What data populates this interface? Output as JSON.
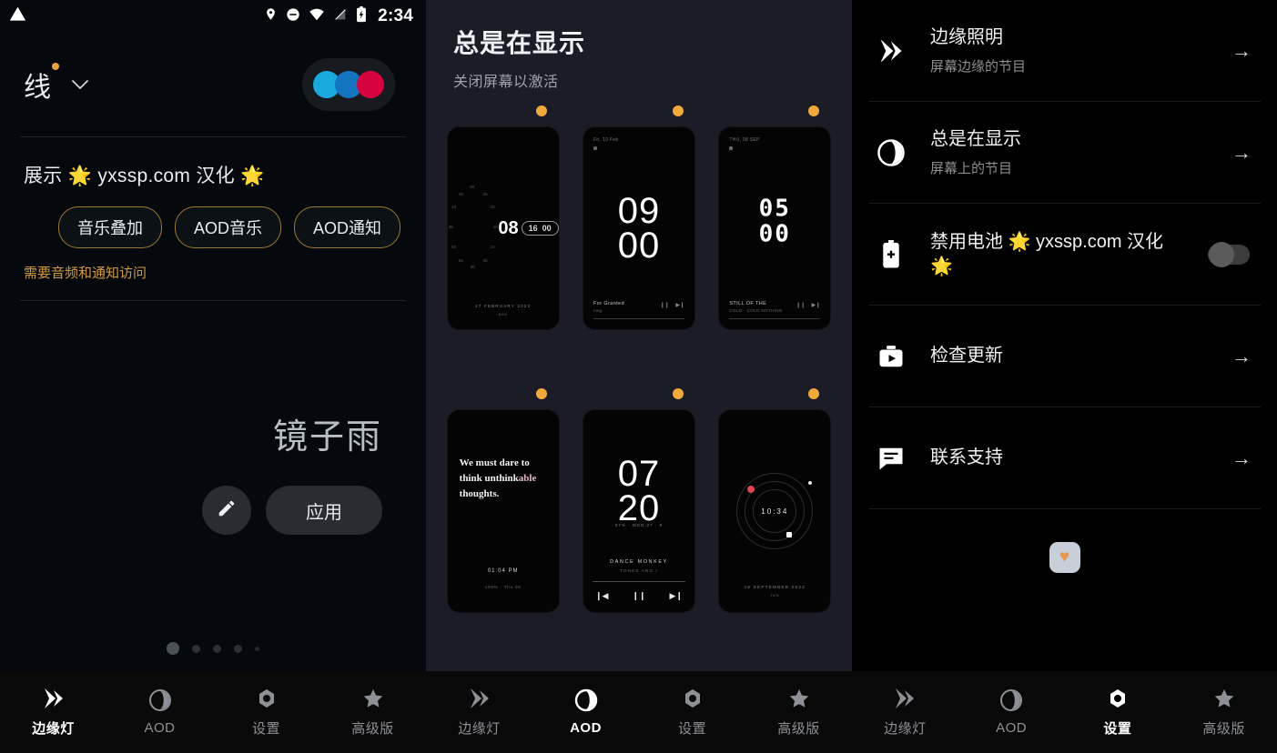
{
  "app": {
    "name": "Edge Lighting / AOD",
    "accent_gold": "#e8a33d",
    "accent_amber": "#f0a93a"
  },
  "panel1": {
    "statusbar": {
      "warning_icon": "warning-triangle-icon",
      "location_icon": "location-pin-icon",
      "dnd_icon": "do-not-disturb-icon",
      "wifi_icon": "wifi-icon",
      "signal_icon": "signal-off-icon",
      "battery_icon": "battery-charging-icon",
      "time": "2:34"
    },
    "profile": {
      "name": "线",
      "chevron_icon": "chevron-down-icon",
      "colors": [
        "#19a9dd",
        "#1474c0",
        "#d6033f"
      ]
    },
    "demo": {
      "label": "展示 🌟 yxssp.com 汉化 🌟",
      "chips": [
        "音乐叠加",
        "AOD音乐",
        "AOD通知"
      ],
      "note": "需要音频和通知访问"
    },
    "preset": {
      "name": "镜子雨",
      "edit_icon": "pencil-edit-icon",
      "apply_label": "应用"
    },
    "pager": {
      "count": 5,
      "active_index": 0
    },
    "tabs": [
      {
        "label": "边缘灯",
        "icon": "edge-light-icon",
        "active": true
      },
      {
        "label": "AOD",
        "icon": "moon-circle-icon",
        "active": false
      },
      {
        "label": "设置",
        "icon": "gear-hex-icon",
        "active": false
      },
      {
        "label": "高级版",
        "icon": "star-icon",
        "active": false
      }
    ]
  },
  "panel2": {
    "title": "总是在显示",
    "subtitle": "关闭屏幕以激活",
    "cards": [
      {
        "id": "radial-dial-clock",
        "style": "dial",
        "hour": "08",
        "minute": "16",
        "extra": "00",
        "date": "17 FEBRUARY 2022",
        "battery": "84%",
        "badge": true
      },
      {
        "id": "big-serif-clock",
        "style": "big",
        "top_date": "Fri, 10 Feb",
        "hour": "09",
        "minute": "00",
        "track_title": "For Granted",
        "track_artist": "nwg",
        "badge": true
      },
      {
        "id": "dot-matrix-clock",
        "style": "dots",
        "top_date": "THU, 08 SEP",
        "hour": "05",
        "minute": "00",
        "track_title": "STILL OF THE",
        "track_artist": "COLD · COLD NOTHING",
        "badge": true
      },
      {
        "id": "quote-clock",
        "style": "quote",
        "quote_a": "We must dare to",
        "quote_b": "think unthink",
        "quote_hl": "able",
        "quote_c": "thoughts.",
        "time": "01:04 PM",
        "meta": "100% · Thu 06",
        "badge": true
      },
      {
        "id": "player-clock",
        "style": "player",
        "hour": "07",
        "minute": "20",
        "meta": "57% · WED 27 · 8",
        "track_title": "DANCE MONKEY",
        "track_artist": "TONES AND I",
        "prev_icon": "skip-previous-icon",
        "pause_icon": "pause-icon",
        "next_icon": "skip-next-icon",
        "badge": true
      },
      {
        "id": "orbit-clock",
        "style": "orbit",
        "time": "10:34",
        "date": "19 SEPTEMBER 2022",
        "battery": "74%",
        "badge": true
      }
    ],
    "tabs": [
      {
        "label": "边缘灯",
        "icon": "edge-light-icon",
        "active": false
      },
      {
        "label": "AOD",
        "icon": "moon-circle-icon",
        "active": true
      },
      {
        "label": "设置",
        "icon": "gear-hex-icon",
        "active": false
      },
      {
        "label": "高级版",
        "icon": "star-icon",
        "active": false
      }
    ]
  },
  "panel3": {
    "rows": [
      {
        "icon": "edge-light-icon",
        "title": "边缘照明",
        "subtitle": "屏幕边缘的节目",
        "control": "arrow",
        "arrow": "→"
      },
      {
        "icon": "moon-circle-icon",
        "title": "总是在显示",
        "subtitle": "屏幕上的节目",
        "control": "arrow",
        "arrow": "→"
      },
      {
        "icon": "battery-plus-icon",
        "title": "禁用电池 🌟 yxssp.com 汉化 🌟",
        "subtitle": "",
        "control": "toggle",
        "toggle_on": false
      },
      {
        "icon": "app-update-icon",
        "title": "检查更新",
        "subtitle": "",
        "control": "arrow",
        "arrow": "→"
      },
      {
        "icon": "chat-support-icon",
        "title": "联系支持",
        "subtitle": "",
        "control": "arrow",
        "arrow": "→"
      }
    ],
    "footer_badge": {
      "icon": "heart-icon",
      "glyph": "♥"
    },
    "tabs": [
      {
        "label": "边缘灯",
        "icon": "edge-light-icon",
        "active": false
      },
      {
        "label": "AOD",
        "icon": "moon-circle-icon",
        "active": false
      },
      {
        "label": "设置",
        "icon": "gear-hex-icon",
        "active": true
      },
      {
        "label": "高级版",
        "icon": "star-icon",
        "active": false
      }
    ]
  }
}
